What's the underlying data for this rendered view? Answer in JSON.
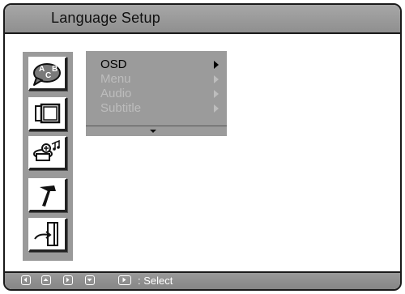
{
  "screen": {
    "title": "Language Setup"
  },
  "side_icons": [
    {
      "icon": "language-abc-icon",
      "selected": true
    },
    {
      "icon": "display-tv-icon",
      "selected": false
    },
    {
      "icon": "audio-speaker-icon",
      "selected": false
    },
    {
      "icon": "hammer-tools-icon",
      "selected": false
    },
    {
      "icon": "exit-door-icon",
      "selected": false
    }
  ],
  "menu": {
    "items": [
      {
        "label": "OSD",
        "state": "active"
      },
      {
        "label": "Menu",
        "state": "disabled"
      },
      {
        "label": "Audio",
        "state": "disabled"
      },
      {
        "label": "Subtitle",
        "state": "disabled"
      }
    ],
    "more_indicator": "chevron-down-icon"
  },
  "help_bar": {
    "keys": [
      "left-arrow-key-icon",
      "up-arrow-key-icon",
      "right-arrow-key-icon",
      "down-arrow-key-icon",
      "play-key-icon"
    ],
    "action_text": ": Select"
  },
  "colors": {
    "panel_gray": "#9b9b9b",
    "active_text": "#000000",
    "disabled_text": "#bdbdbd",
    "frame": "#1a1a1a"
  }
}
